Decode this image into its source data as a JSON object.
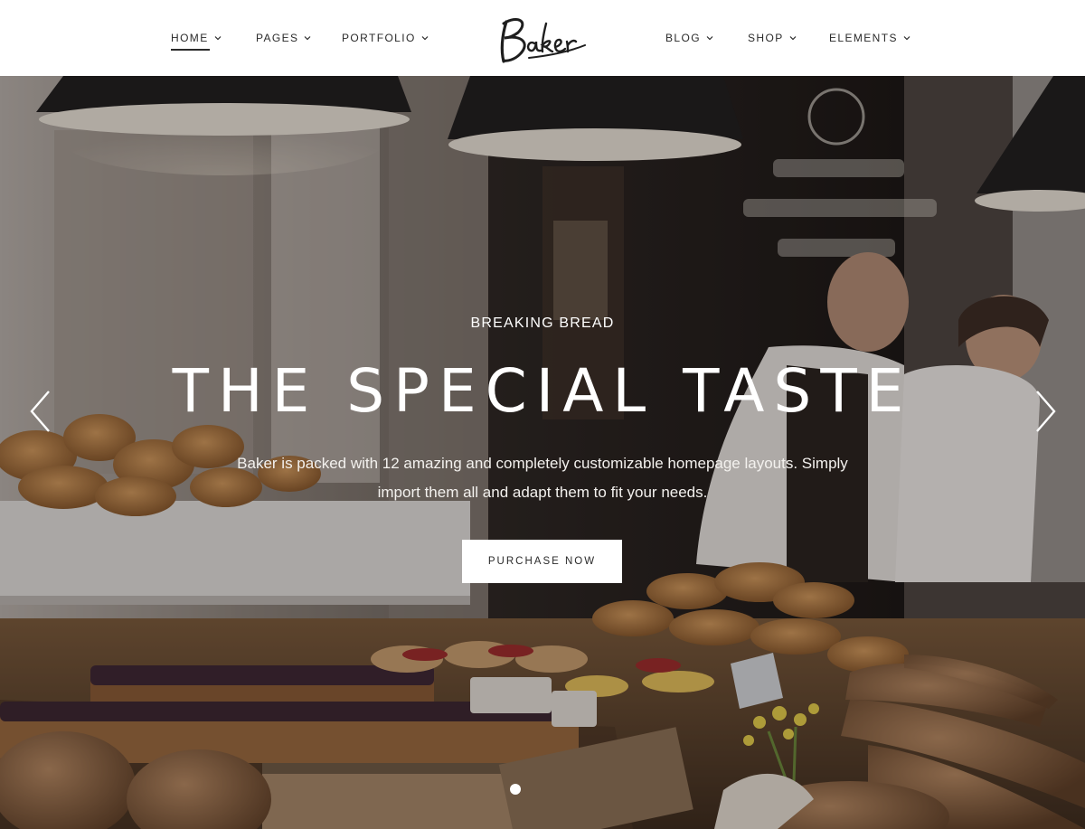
{
  "brand": {
    "logo_text": "Baker"
  },
  "nav": {
    "left": [
      {
        "label": "HOME",
        "active": true
      },
      {
        "label": "PAGES",
        "active": false
      },
      {
        "label": "PORTFOLIO",
        "active": false
      }
    ],
    "right": [
      {
        "label": "BLOG",
        "active": false
      },
      {
        "label": "SHOP",
        "active": false
      },
      {
        "label": "ELEMENTS",
        "active": false
      }
    ]
  },
  "hero": {
    "eyebrow": "BREAKING BREAD",
    "title": "THE SPECIAL TASTE",
    "description": "Baker is packed with 12 amazing and completely customizable homepage layouts. Simply import them all and adapt them to fit your needs.",
    "cta_label": "PURCHASE NOW",
    "slide_count": 1,
    "active_slide": 1
  },
  "icons": {
    "chevron": "chevron-down-icon",
    "prev": "chevron-left-icon",
    "next": "chevron-right-icon"
  },
  "colors": {
    "header_bg": "#ffffff",
    "nav_text": "#2a2a2a",
    "hero_text": "#ffffff",
    "cta_bg": "#ffffff"
  }
}
